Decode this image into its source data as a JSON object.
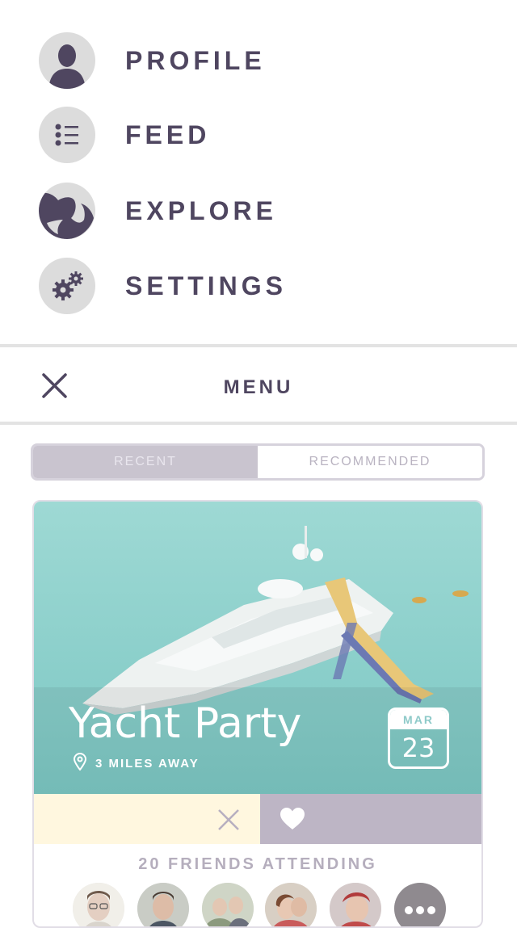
{
  "menu": {
    "items": [
      {
        "label": "PROFILE",
        "icon": "profile-icon"
      },
      {
        "label": "FEED",
        "icon": "list-icon"
      },
      {
        "label": "EXPLORE",
        "icon": "globe-icon"
      },
      {
        "label": "SETTINGS",
        "icon": "gears-icon"
      }
    ]
  },
  "menu_bar": {
    "title": "MENU",
    "close_icon": "close-icon"
  },
  "tabs": [
    {
      "label": "RECENT",
      "active": true
    },
    {
      "label": "RECOMMENDED",
      "active": false
    }
  ],
  "event": {
    "title": "Yacht Party",
    "distance": "3 MILES AWAY",
    "month": "MAR",
    "day": "23",
    "friends_attending": "20 FRIENDS ATTENDING"
  },
  "colors": {
    "menu_text": "#4f4660",
    "icon_bg": "#dcdcdc",
    "skip_bg": "#fff7df",
    "like_bg": "#bdb5c5",
    "photo_sea": "#8fd4cf"
  }
}
